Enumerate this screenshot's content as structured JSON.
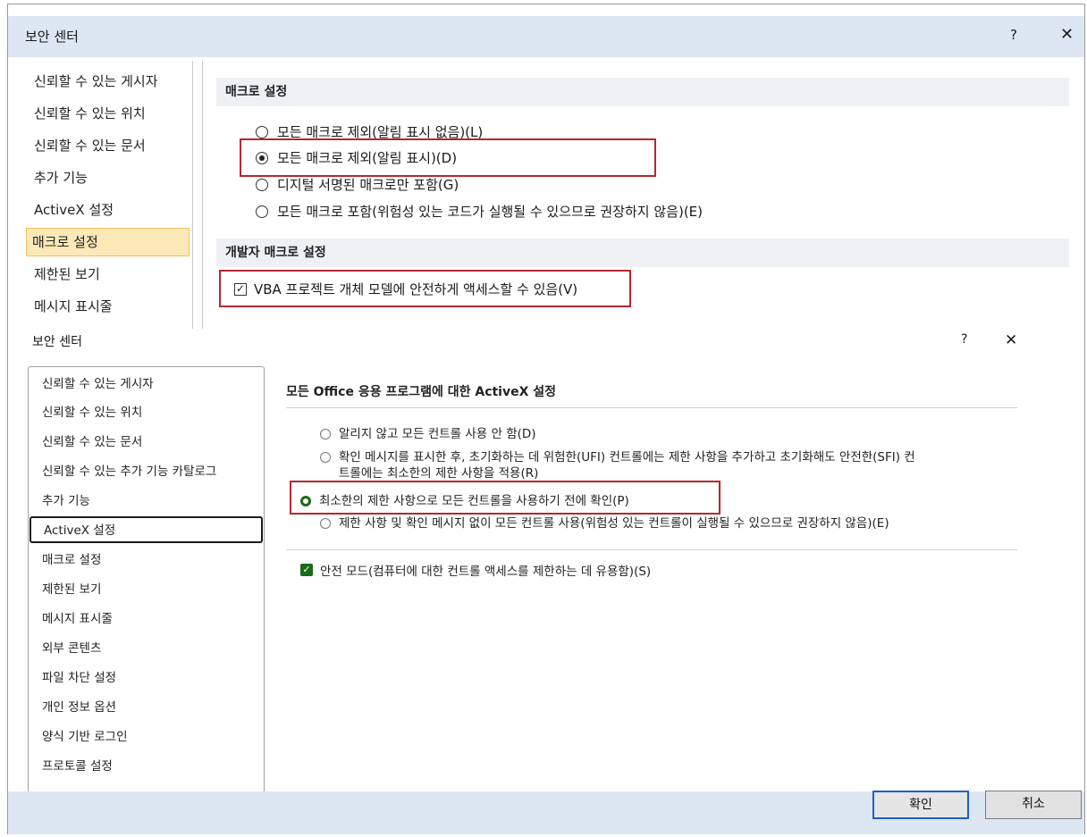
{
  "dialog1": {
    "title": "보안 센터",
    "help": "?",
    "close": "✕",
    "nav": [
      {
        "label": "신뢰할 수 있는 게시자"
      },
      {
        "label": "신뢰할 수 있는 위치"
      },
      {
        "label": "신뢰할 수 있는 문서"
      },
      {
        "label": "추가 기능"
      },
      {
        "label": "ActiveX 설정"
      },
      {
        "label": "매크로 설정"
      },
      {
        "label": "제한된 보기"
      },
      {
        "label": "메시지 표시줄"
      }
    ],
    "selected_nav": "매크로 설정",
    "macro_section": "매크로 설정",
    "macro_options": [
      {
        "label": "모든 매크로 제외(알림 표시 없음)(L)",
        "checked": false
      },
      {
        "label": "모든 매크로 제외(알림 표시)(D)",
        "checked": true
      },
      {
        "label": "디지털 서명된 매크로만 포함(G)",
        "checked": false
      },
      {
        "label": "모든 매크로 포함(위험성 있는 코드가 실행될 수 있으므로 권장하지 않음)(E)",
        "checked": false
      }
    ],
    "dev_section": "개발자 매크로 설정",
    "vba_checkbox": {
      "label": "VBA 프로젝트 개체 모델에 안전하게 액세스할 수 있음(V)",
      "checked": true,
      "mark": "✓"
    }
  },
  "dialog2": {
    "title": "보안 센터",
    "help": "?",
    "close": "✕",
    "nav": [
      {
        "label": "신뢰할 수 있는 게시자"
      },
      {
        "label": "신뢰할 수 있는 위치"
      },
      {
        "label": "신뢰할 수 있는 문서"
      },
      {
        "label": "신뢰할 수 있는 추가 기능 카탈로그"
      },
      {
        "label": "추가 기능"
      },
      {
        "label": "ActiveX 설정"
      },
      {
        "label": "매크로 설정"
      },
      {
        "label": "제한된 보기"
      },
      {
        "label": "메시지 표시줄"
      },
      {
        "label": "외부 콘텐츠"
      },
      {
        "label": "파일 차단 설정"
      },
      {
        "label": "개인 정보 옵션"
      },
      {
        "label": "양식 기반 로그인"
      },
      {
        "label": "프로토콜 설정"
      }
    ],
    "selected_nav": "ActiveX 설정",
    "heading": "모든 Office 응용 프로그램에 대한 ActiveX 설정",
    "options": [
      {
        "line1": "알리지 않고 모든 컨트롤 사용 안 함(D)",
        "line2": "",
        "checked": false
      },
      {
        "line1": "확인 메시지를 표시한 후, 초기화하는 데 위험한(UFI) 컨트롤에는 제한 사항을 추가하고 초기화해도 안전한(SFI) 컨",
        "line2": "트롤에는 최소한의 제한 사항을 적용(R)",
        "checked": false
      },
      {
        "line1": "최소한의 제한 사항으로 모든 컨트롤을 사용하기 전에 확인(P)",
        "line2": "",
        "checked": true
      },
      {
        "line1": "제한 사항 및 확인 메시지 없이 모든 컨트롤 사용(위험성 있는 컨트롤이 실행될 수 있으므로 권장하지 않음)(E)",
        "line2": "",
        "checked": false
      }
    ],
    "safe_mode": {
      "label": "안전 모드(컴퓨터에 대한 컨트롤 액세스를 제한하는 데 유용함)(S)",
      "checked": true,
      "mark": "✓"
    },
    "ok_button": "확인",
    "cancel_button": "취소"
  },
  "colors": {
    "highlight_red": "#b5272f",
    "selected_nav_bg": "#fde9b8",
    "titlebar_bg": "#dde6f3",
    "accent_green": "#1a6b1a",
    "default_button_border": "#1c5fd0"
  }
}
